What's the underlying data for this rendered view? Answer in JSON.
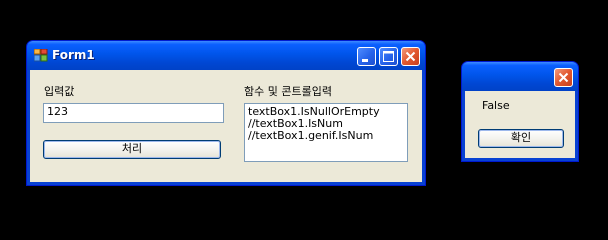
{
  "form1": {
    "title": "Form1",
    "input_label": "입력값",
    "input_value": "123",
    "process_button": "처리",
    "function_label": "함수 및 콘트롤입력",
    "code_lines": [
      "textBox1.IsNullOrEmpty",
      "//textBox1.IsNum",
      "//textBox1.genif.IsNum"
    ]
  },
  "message_box": {
    "message": "False",
    "ok_button": "확인"
  },
  "icons": {
    "app": "form-app-icon",
    "minimize": "minimize-icon",
    "maximize": "maximize-icon",
    "close": "close-icon"
  },
  "colors": {
    "titlebar": "#0055ea",
    "client": "#ece9d8",
    "close_button": "#e2582f"
  }
}
